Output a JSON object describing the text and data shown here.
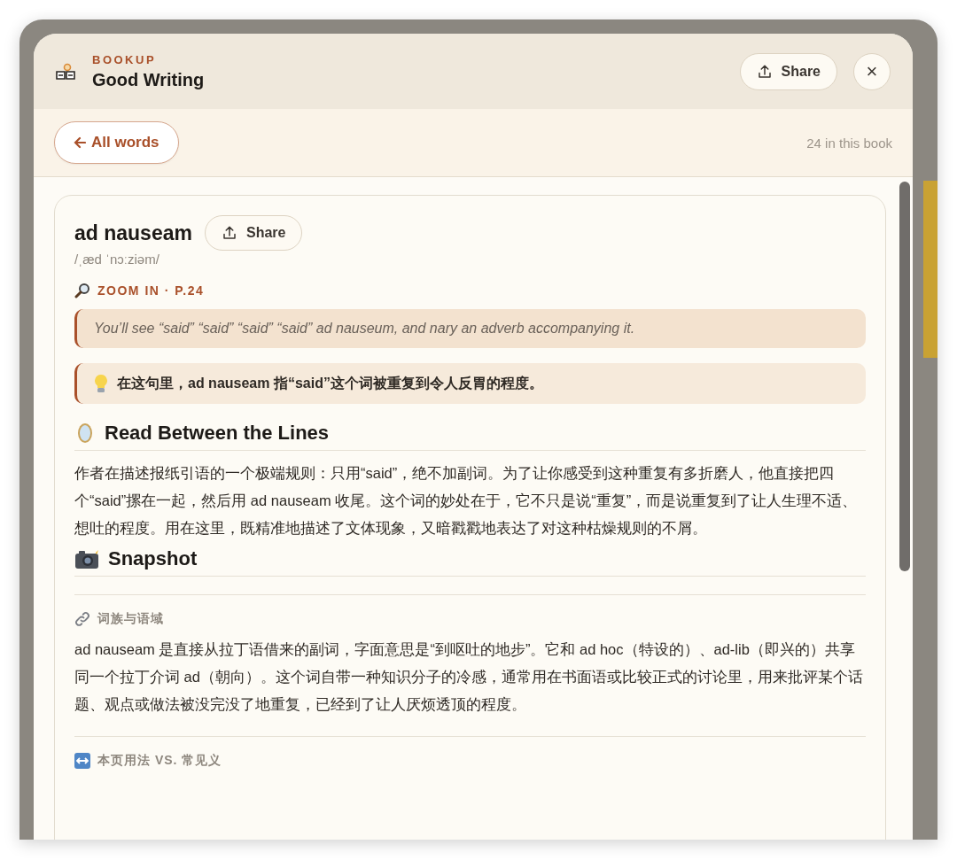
{
  "header": {
    "brand": "BOOKUP",
    "title": "Good Writing",
    "share": "Share",
    "close": "×"
  },
  "nav": {
    "back": "All words",
    "count": "24 in this book"
  },
  "entry": {
    "word": "ad nauseam",
    "share": "Share",
    "pronunciation": "/ˌæd ˈnɔːziəm/",
    "source": "ZOOM IN · P.24",
    "quote": "You’ll see “said” “said” “said” “said” ad nauseum, and nary an adverb accompanying it.",
    "note": "在这句里，ad nauseam 指“said”这个词被重复到令人反胃的程度。"
  },
  "sections": [
    {
      "kind": "heading",
      "title": "Read Between the Lines",
      "body": "作者在描述报纸引语的一个极端规则：只用“said”，绝不加副词。为了让你感受到这种重复有多折磨人，他直接把四个“said”摞在一起，然后用 ad nauseam 收尾。这个词的妙处在于，它不只是说“重复”，而是说重复到了让人生理不适、想吐的程度。用在这里，既精准地描述了文体现象，又暗戳戳地表达了对这种枯燥规则的不屑。"
    },
    {
      "kind": "heading",
      "title": "Snapshot"
    },
    {
      "kind": "subsection",
      "title": "词族与语域",
      "body": "ad nauseam 是直接从拉丁语借来的副词，字面意思是“到呕吐的地步”。它和 ad hoc（特设的）、ad-lib（即兴的）共享同一个拉丁介词 ad（朝向）。这个词自带一种知识分子的冷感，通常用在书面语或比较正式的讨论里，用来批评某个话题、观点或做法被没完没了地重复，已经到了让人厌烦透顶的程度。"
    },
    {
      "kind": "subsection",
      "title": "本页用法 VS. 常见义"
    }
  ]
}
